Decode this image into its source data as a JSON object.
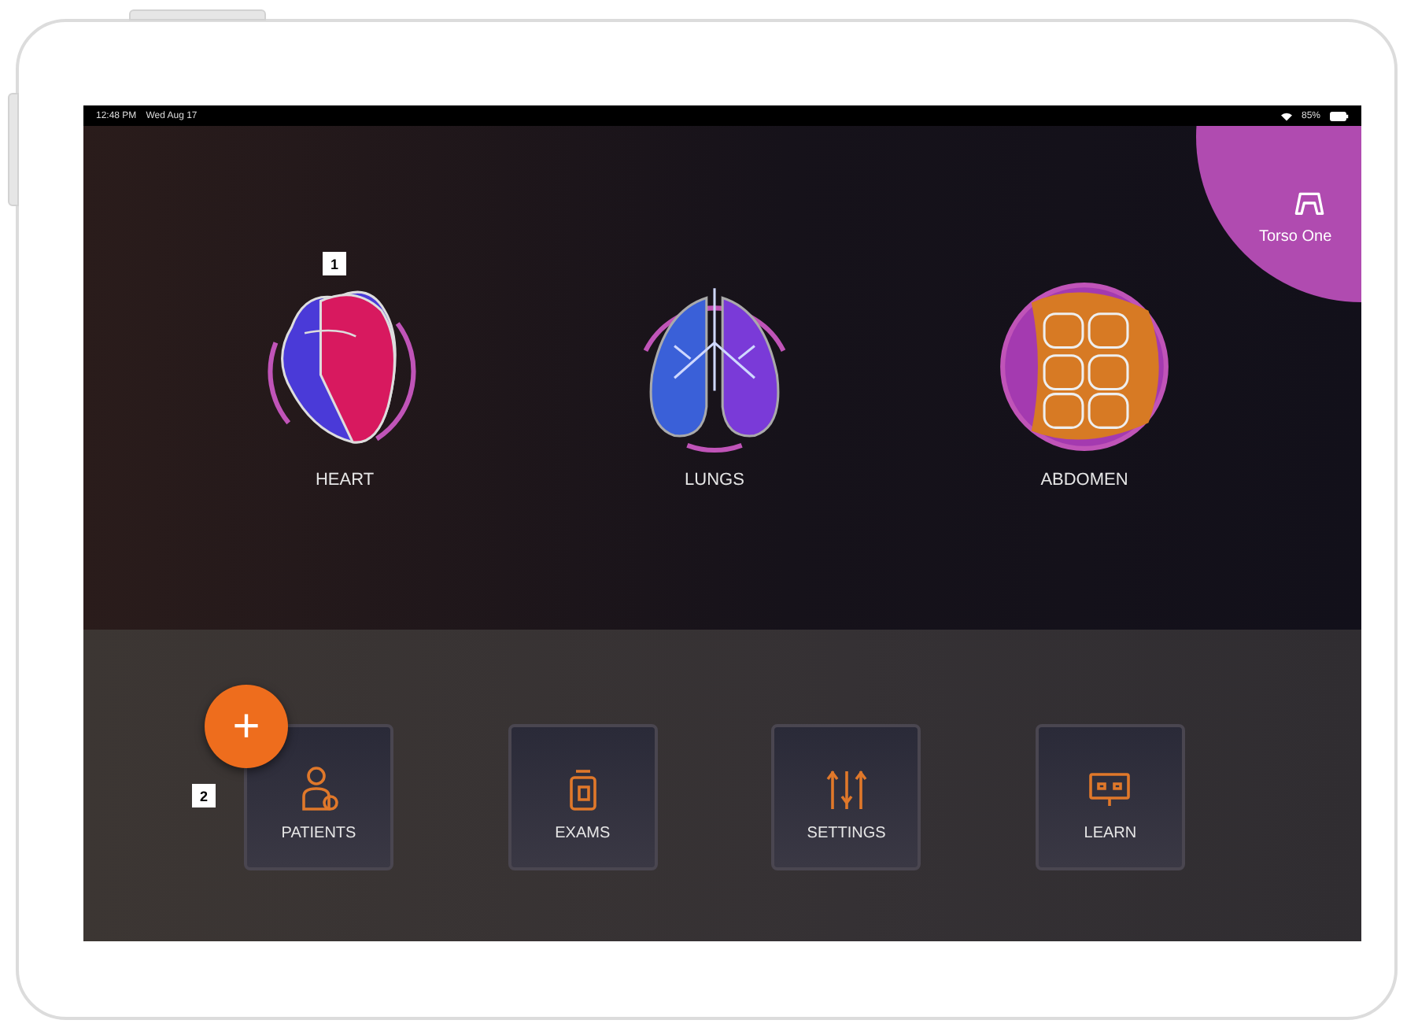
{
  "status_bar": {
    "time": "12:48 PM",
    "date": "Wed Aug 17",
    "battery": "85%"
  },
  "device_button": {
    "label": "Torso One"
  },
  "organs": [
    {
      "kind": "heart",
      "label": "HEART"
    },
    {
      "kind": "lungs",
      "label": "LUNGS"
    },
    {
      "kind": "abdomen",
      "label": "ABDOMEN"
    }
  ],
  "callouts": [
    "1",
    "2"
  ],
  "add_button": {
    "label": "+"
  },
  "nav_buttons": [
    {
      "kind": "patients",
      "label": "PATIENTS"
    },
    {
      "kind": "exams",
      "label": "EXAMS"
    },
    {
      "kind": "settings",
      "label": "SETTINGS"
    },
    {
      "kind": "learn",
      "label": "LEARN"
    }
  ]
}
